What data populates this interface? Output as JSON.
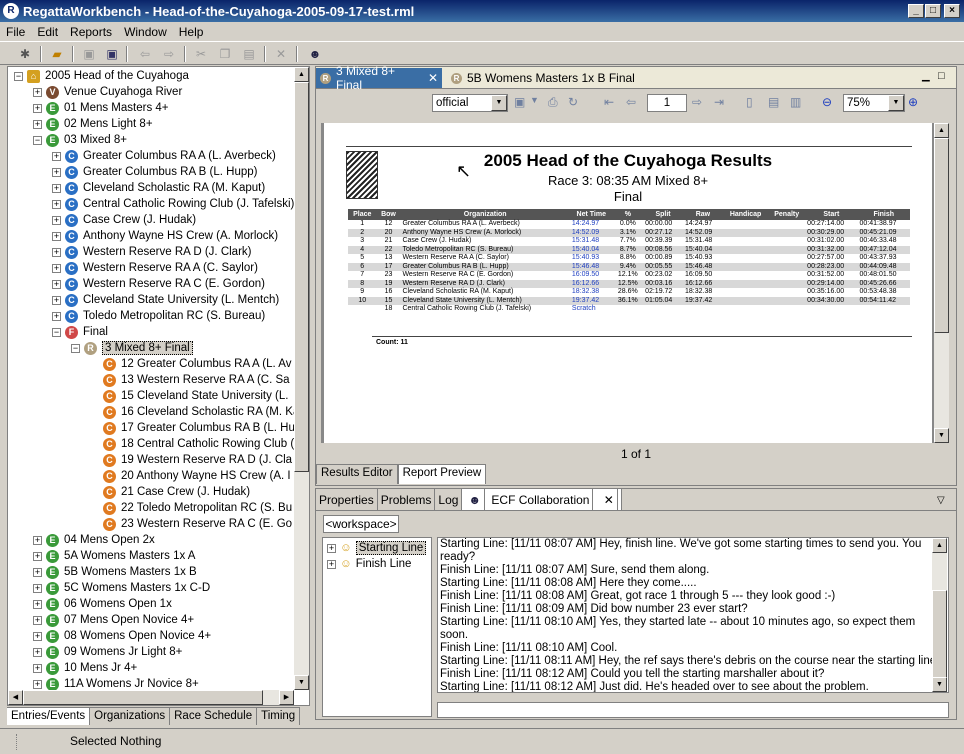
{
  "window": {
    "title": "RegattaWorkbench - Head-of-the-Cuyahoga-2005-09-17-test.rml",
    "min": "_",
    "max": "□",
    "close": "×"
  },
  "menu": [
    "File",
    "Edit",
    "Reports",
    "Window",
    "Help"
  ],
  "tree": [
    {
      "label": "2005 Head of the Cuyahoga",
      "icon": "home",
      "exp": "−",
      "indent": 0
    },
    {
      "label": "Venue Cuyahoga River",
      "icon": "V",
      "exp": "+",
      "indent": 1
    },
    {
      "label": "01  Mens Masters 4+",
      "icon": "E",
      "exp": "+",
      "indent": 1
    },
    {
      "label": "02  Mens Light 8+",
      "icon": "E",
      "exp": "+",
      "indent": 1
    },
    {
      "label": "03  Mixed 8+",
      "icon": "E",
      "exp": "−",
      "indent": 1
    },
    {
      "label": "Greater Columbus RA A  (L. Averbeck)",
      "icon": "C",
      "exp": "+",
      "indent": 2
    },
    {
      "label": "Greater Columbus RA B  (L. Hupp)",
      "icon": "C",
      "exp": "+",
      "indent": 2
    },
    {
      "label": "Cleveland Scholastic RA  (M. Kaput)",
      "icon": "C",
      "exp": "+",
      "indent": 2
    },
    {
      "label": "Central Catholic Rowing Club  (J. Tafelski)",
      "icon": "C",
      "exp": "+",
      "indent": 2
    },
    {
      "label": "Case Crew  (J. Hudak)",
      "icon": "C",
      "exp": "+",
      "indent": 2
    },
    {
      "label": "Anthony Wayne HS Crew  (A. Morlock)",
      "icon": "C",
      "exp": "+",
      "indent": 2
    },
    {
      "label": "Western Reserve RA D  (J. Clark)",
      "icon": "C",
      "exp": "+",
      "indent": 2
    },
    {
      "label": "Western Reserve RA A  (C. Saylor)",
      "icon": "C",
      "exp": "+",
      "indent": 2
    },
    {
      "label": "Western Reserve RA C  (E. Gordon)",
      "icon": "C",
      "exp": "+",
      "indent": 2
    },
    {
      "label": "Cleveland State University  (L. Mentch)",
      "icon": "C",
      "exp": "+",
      "indent": 2
    },
    {
      "label": "Toledo Metropolitan RC  (S. Bureau)",
      "icon": "C",
      "exp": "+",
      "indent": 2
    },
    {
      "label": "Final",
      "icon": "F",
      "exp": "−",
      "indent": 2
    },
    {
      "label": "3  Mixed 8+ Final",
      "icon": "R",
      "exp": "−",
      "indent": 3,
      "selected": true
    },
    {
      "label": "12  Greater Columbus RA A  (L. Av",
      "icon": "O",
      "exp": "",
      "indent": 4
    },
    {
      "label": "13  Western Reserve RA A  (C. Sa",
      "icon": "O",
      "exp": "",
      "indent": 4
    },
    {
      "label": "15  Cleveland State University  (L.",
      "icon": "O",
      "exp": "",
      "indent": 4
    },
    {
      "label": "16  Cleveland Scholastic RA  (M. Ka",
      "icon": "O",
      "exp": "",
      "indent": 4
    },
    {
      "label": "17  Greater Columbus RA B  (L. Hu",
      "icon": "O",
      "exp": "",
      "indent": 4
    },
    {
      "label": "18  Central Catholic Rowing Club  (",
      "icon": "O",
      "exp": "",
      "indent": 4
    },
    {
      "label": "19  Western Reserve RA D  (J. Cla",
      "icon": "O",
      "exp": "",
      "indent": 4
    },
    {
      "label": "20  Anthony Wayne HS Crew  (A. I",
      "icon": "O",
      "exp": "",
      "indent": 4
    },
    {
      "label": "21  Case Crew  (J. Hudak)",
      "icon": "O",
      "exp": "",
      "indent": 4
    },
    {
      "label": "22  Toledo Metropolitan RC  (S. Bu",
      "icon": "O",
      "exp": "",
      "indent": 4
    },
    {
      "label": "23  Western Reserve RA C  (E. Go",
      "icon": "O",
      "exp": "",
      "indent": 4
    },
    {
      "label": "04  Mens Open 2x",
      "icon": "E",
      "exp": "+",
      "indent": 1
    },
    {
      "label": "5A  Womens Masters 1x A",
      "icon": "E",
      "exp": "+",
      "indent": 1
    },
    {
      "label": "5B  Womens Masters 1x B",
      "icon": "E",
      "exp": "+",
      "indent": 1
    },
    {
      "label": "5C  Womens Masters 1x C-D",
      "icon": "E",
      "exp": "+",
      "indent": 1
    },
    {
      "label": "06  Womens Open 1x",
      "icon": "E",
      "exp": "+",
      "indent": 1
    },
    {
      "label": "07  Mens Open Novice 4+",
      "icon": "E",
      "exp": "+",
      "indent": 1
    },
    {
      "label": "08  Womens Open Novice 4+",
      "icon": "E",
      "exp": "+",
      "indent": 1
    },
    {
      "label": "09  Womens Jr Light 8+",
      "icon": "E",
      "exp": "+",
      "indent": 1
    },
    {
      "label": "10  Mens Jr 4+",
      "icon": "E",
      "exp": "+",
      "indent": 1
    },
    {
      "label": "11A  Womens Jr Novice 8+",
      "icon": "E",
      "exp": "+",
      "indent": 1
    }
  ],
  "left_tabs": [
    "Entries/Events",
    "Organizations",
    "Race Schedule",
    "Timing"
  ],
  "editor_tabs": [
    {
      "label": "3  Mixed 8+ Final"
    },
    {
      "label": "5B  Womens Masters 1x B Final"
    }
  ],
  "report_toolbar": {
    "format": "official",
    "page": "1",
    "zoom": "75%"
  },
  "report": {
    "title": "2005 Head of the Cuyahoga Results",
    "subtitle": "Race 3:  08:35 AM  Mixed 8+",
    "stage": "Final",
    "columns": [
      "Place",
      "Bow",
      "Organization",
      "Net Time",
      "%",
      "Split",
      "Raw",
      "Handicap",
      "Penalty",
      "Start",
      "Finish"
    ],
    "rows": [
      [
        "1",
        "12",
        "Greater Columbus RA A  (L. Averbeck)",
        "14:24.97",
        "0.0%",
        "00:00.00",
        "14:24.97",
        "",
        "",
        "00:27:14.00",
        "00:41:38.97"
      ],
      [
        "2",
        "20",
        "Anthony Wayne HS Crew  (A. Morlock)",
        "14:52.09",
        "3.1%",
        "00:27.12",
        "14:52.09",
        "",
        "",
        "00:30:29.00",
        "00:45:21.09"
      ],
      [
        "3",
        "21",
        "Case Crew  (J. Hudak)",
        "15:31.48",
        "7.7%",
        "00:39.39",
        "15:31.48",
        "",
        "",
        "00:31:02.00",
        "00:46:33.48"
      ],
      [
        "4",
        "22",
        "Toledo Metropolitan RC  (S. Bureau)",
        "15:40.04",
        "8.7%",
        "00:08.56",
        "15:40.04",
        "",
        "",
        "00:31:32.00",
        "00:47:12.04"
      ],
      [
        "5",
        "13",
        "Western Reserve RA A  (C. Saylor)",
        "15:40.93",
        "8.8%",
        "00:00.89",
        "15:40.93",
        "",
        "",
        "00:27:57.00",
        "00:43:37.93"
      ],
      [
        "6",
        "17",
        "Greater Columbus RA B  (L. Hupp)",
        "15:46.48",
        "9.4%",
        "00:05.55",
        "15:46.48",
        "",
        "",
        "00:28:23.00",
        "00:44:09.48"
      ],
      [
        "7",
        "23",
        "Western Reserve RA C  (E. Gordon)",
        "16:09.50",
        "12.1%",
        "00:23.02",
        "16:09.50",
        "",
        "",
        "00:31:52.00",
        "00:48:01.50"
      ],
      [
        "8",
        "19",
        "Western Reserve RA D  (J. Clark)",
        "16:12.66",
        "12.5%",
        "00:03.16",
        "16:12.66",
        "",
        "",
        "00:29:14.00",
        "00:45:26.66"
      ],
      [
        "9",
        "16",
        "Cleveland Scholastic RA  (M. Kaput)",
        "18:32.38",
        "28.6%",
        "02:19.72",
        "18:32.38",
        "",
        "",
        "00:35:16.00",
        "00:53:48.38"
      ],
      [
        "10",
        "15",
        "Cleveland State University  (L. Mentch)",
        "19:37.42",
        "36.1%",
        "01:05.04",
        "19:37.42",
        "",
        "",
        "00:34:30.00",
        "00:54:11.42"
      ],
      [
        "",
        "18",
        "Central Catholic Rowing Club  (J. Tafelski)",
        "Scratch",
        "",
        "",
        "",
        "",
        "",
        "",
        ""
      ]
    ],
    "count": "Count: 11",
    "page_label": "1 of 1"
  },
  "report_tabs": [
    "Results Editor",
    "Report Preview"
  ],
  "bottom_tabs": [
    "Properties",
    "Problems",
    "Log",
    "ECF Collaboration"
  ],
  "workspace": "<workspace>",
  "roster": [
    "Starting Line",
    "Finish Line"
  ],
  "chat": [
    "Starting Line: [11/11 08:07 AM] Hey, finish line. We've got some starting times to send you. You ready?",
    "Finish Line: [11/11 08:07 AM] Sure, send them along.",
    "Starting Line: [11/11 08:08 AM] Here they come.....",
    "Finish Line: [11/11 08:08 AM] Great, got race 1 through 5 --- they look good :-)",
    "Finish Line: [11/11 08:09 AM] Did bow number 23 ever start?",
    "Starting Line: [11/11 08:10 AM] Yes, they started late -- about 10 minutes ago, so expect them soon.",
    "Finish Line: [11/11 08:10 AM] Cool.",
    "Starting Line: [11/11 08:11 AM] Hey, the ref says there's debris on the course near the starting line.",
    "Finish Line: [11/11 08:12 AM] Could you tell the starting marshaller about it?",
    "Starting Line: [11/11 08:12 AM] Just did. He's headed over to see about the problem."
  ],
  "status": "Selected Nothing"
}
